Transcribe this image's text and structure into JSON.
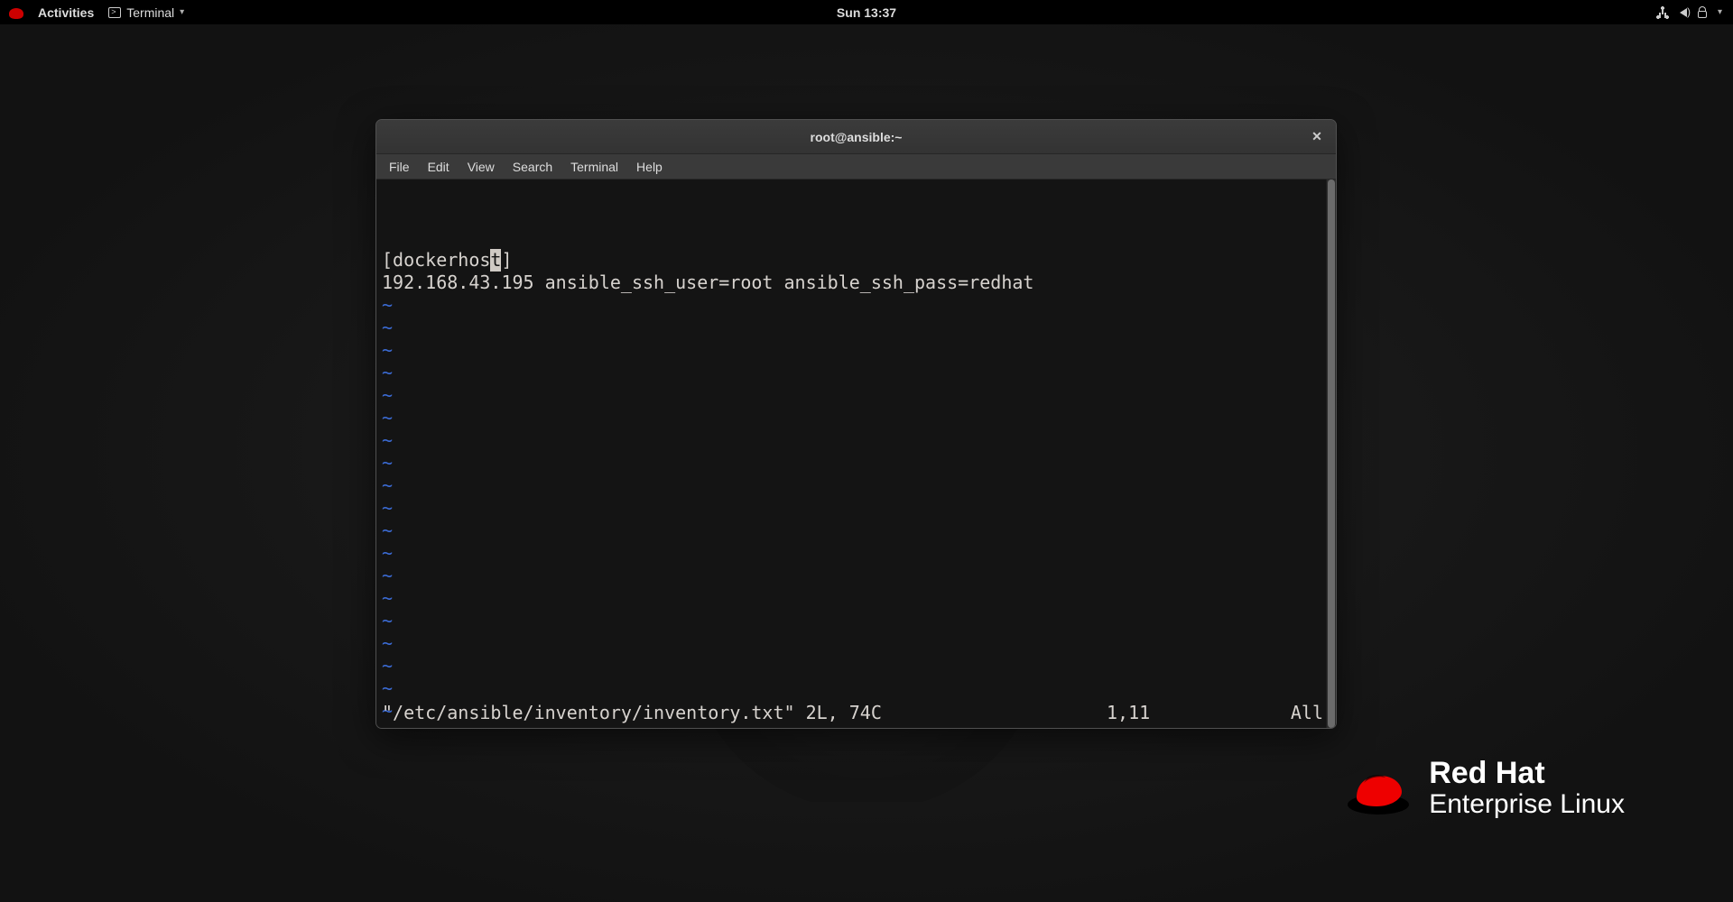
{
  "topbar": {
    "activities": "Activities",
    "terminal_label": "Terminal",
    "clock": "Sun 13:37"
  },
  "window": {
    "title": "root@ansible:~",
    "menus": [
      "File",
      "Edit",
      "View",
      "Search",
      "Terminal",
      "Help"
    ]
  },
  "editor": {
    "line1_pre": "[dockerhos",
    "line1_cursor": "t",
    "line1_post": "]",
    "line2": "192.168.43.195 ansible_ssh_user=root ansible_ssh_pass=redhat",
    "tilde_rows": 20,
    "status_file": "\"/etc/ansible/inventory/inventory.txt\" 2L, 74C",
    "status_pos": "1,11",
    "status_all": "All"
  },
  "branding": {
    "line1": "Red Hat",
    "line2": "Enterprise Linux"
  }
}
